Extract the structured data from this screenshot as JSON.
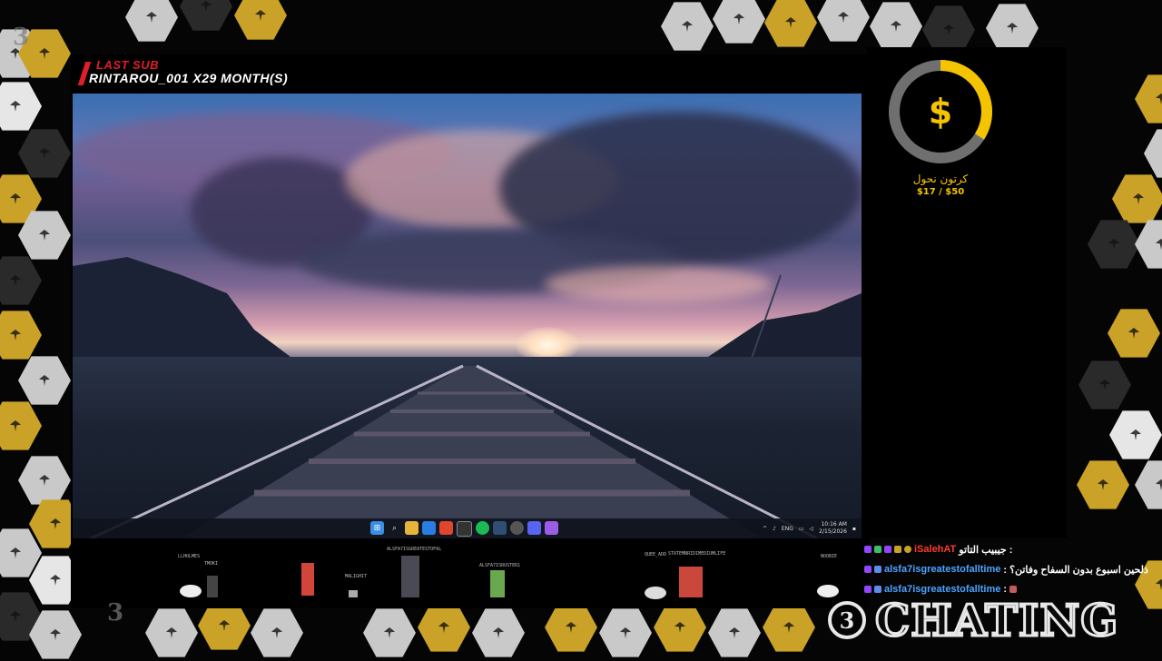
{
  "last_sub": {
    "title": "LAST SUB",
    "name": "RINTAROU_001 X29 MONTH(S)"
  },
  "desktop": {
    "taskbar": {
      "icons": [
        "windows-icon",
        "search-icon",
        "file-explorer-icon",
        "edge-icon",
        "brave-icon",
        "obs-icon",
        "spotify-icon",
        "steam-icon",
        "cortana-icon",
        "discord-icon",
        "app-icon"
      ],
      "language": "ENG",
      "time": "10:16 AM",
      "date": "2/15/2026"
    }
  },
  "goal": {
    "label": "كرتون نحول",
    "amount": "$17 / $50",
    "current": 17,
    "target": 50,
    "symbol": "$",
    "color": "#f5c400"
  },
  "viewers": [
    {
      "name": "LLHOLMES"
    },
    {
      "name": "TMOKI"
    },
    {
      "name": "ALSFA7ISGREATESTOFAL"
    },
    {
      "name": "MALIGHIT"
    },
    {
      "name": "ALSFA7ISRUSTER1"
    },
    {
      "name": "QUEE_ADD"
    },
    {
      "name": "STATEMNRIDIMEDIUMLIFE"
    },
    {
      "name": "NOOBIE"
    }
  ],
  "chat": [
    {
      "user": "iSalehAT",
      "text": "جيبيب التاتو :",
      "user_color": "#ff3b30"
    },
    {
      "user": "alsfa7isgreatestofalltime",
      "text": ": ذلحين اسبوع بدون السفاح وفاتن؟",
      "user_color": "#4da3ff"
    },
    {
      "user": "alsfa7isgreatestofalltime",
      "text": ":",
      "user_color": "#4da3ff"
    }
  ],
  "chatting_logo": {
    "number": "3",
    "word": "CHATING"
  },
  "colors": {
    "accent_red": "#e11d2a",
    "gold": "#c9a227"
  }
}
